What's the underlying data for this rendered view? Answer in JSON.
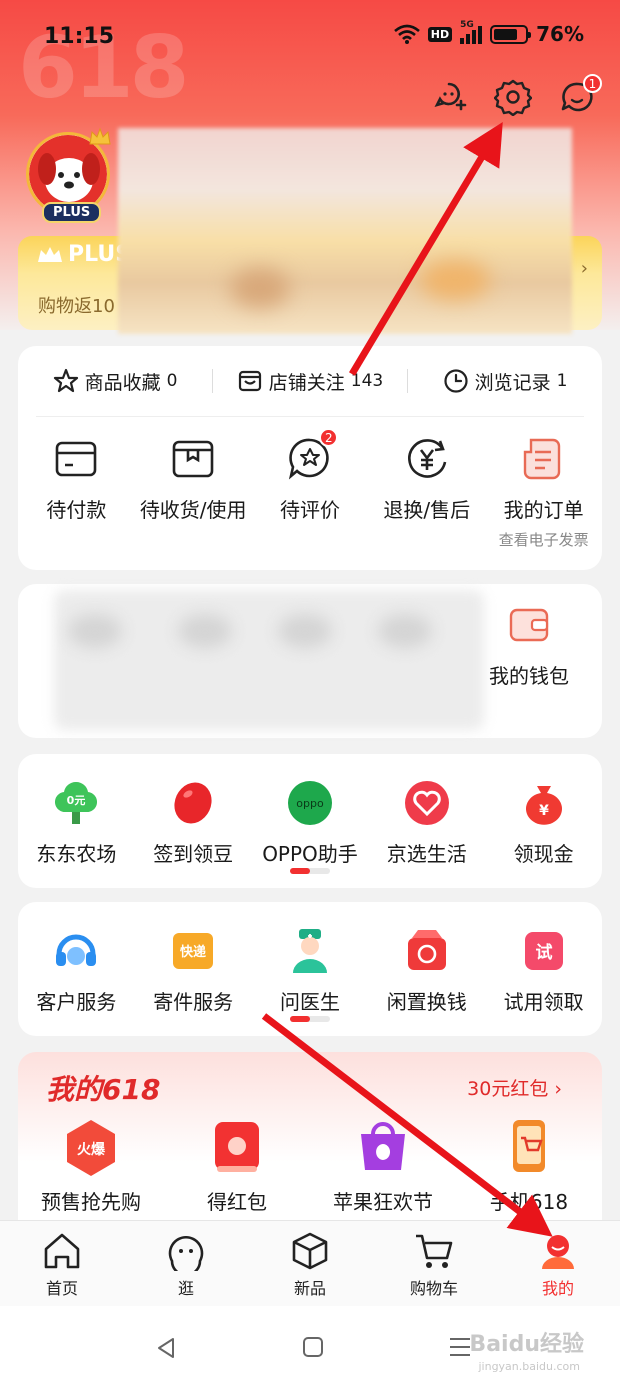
{
  "status": {
    "time": "11:15",
    "network": "HD",
    "signal": "5G",
    "battery": "76%",
    "battery_level": 0.76
  },
  "header": {
    "background_text": "618",
    "message_badge": "1",
    "plus_tag": "PLUS"
  },
  "plus_card": {
    "title": "PLUS",
    "subtitle": "购物返10",
    "arrow": "›"
  },
  "stats": [
    {
      "label": "商品收藏",
      "count": "0"
    },
    {
      "label": "店铺关注",
      "count": "143"
    },
    {
      "label": "浏览记录",
      "count": "1"
    }
  ],
  "orders": [
    {
      "label": "待付款"
    },
    {
      "label": "待收货/使用"
    },
    {
      "label": "待评价",
      "badge": "2"
    },
    {
      "label": "退换/售后"
    },
    {
      "label": "我的订单",
      "sub": "查看电子发票"
    }
  ],
  "wallet": {
    "label": "我的钱包"
  },
  "services1": [
    {
      "label": "东东农场",
      "icon_text": "0元"
    },
    {
      "label": "签到领豆"
    },
    {
      "label": "OPPO助手",
      "icon_text": "oppo"
    },
    {
      "label": "京选生活"
    },
    {
      "label": "领现金"
    }
  ],
  "services2": [
    {
      "label": "客户服务"
    },
    {
      "label": "寄件服务",
      "icon_text": "快递"
    },
    {
      "label": "问医生"
    },
    {
      "label": "闲置换钱"
    },
    {
      "label": "试用领取",
      "icon_text": "试"
    }
  ],
  "my618": {
    "title": "我的618",
    "link": "30元红包 ›",
    "items": [
      {
        "label": "预售抢先购",
        "icon_text": "火爆"
      },
      {
        "label": "得红包"
      },
      {
        "label": "苹果狂欢节"
      },
      {
        "label": "手机618"
      }
    ]
  },
  "nav": [
    {
      "label": "首页"
    },
    {
      "label": "逛"
    },
    {
      "label": "新品"
    },
    {
      "label": "购物车"
    },
    {
      "label": "我的",
      "active": true
    }
  ],
  "watermark": {
    "text": "Baidu经验",
    "sub": "jingyan.baidu.com"
  },
  "colors": {
    "accent": "#f23030",
    "plus_gold": "#fbd45a",
    "arrow": "#e8141a"
  }
}
